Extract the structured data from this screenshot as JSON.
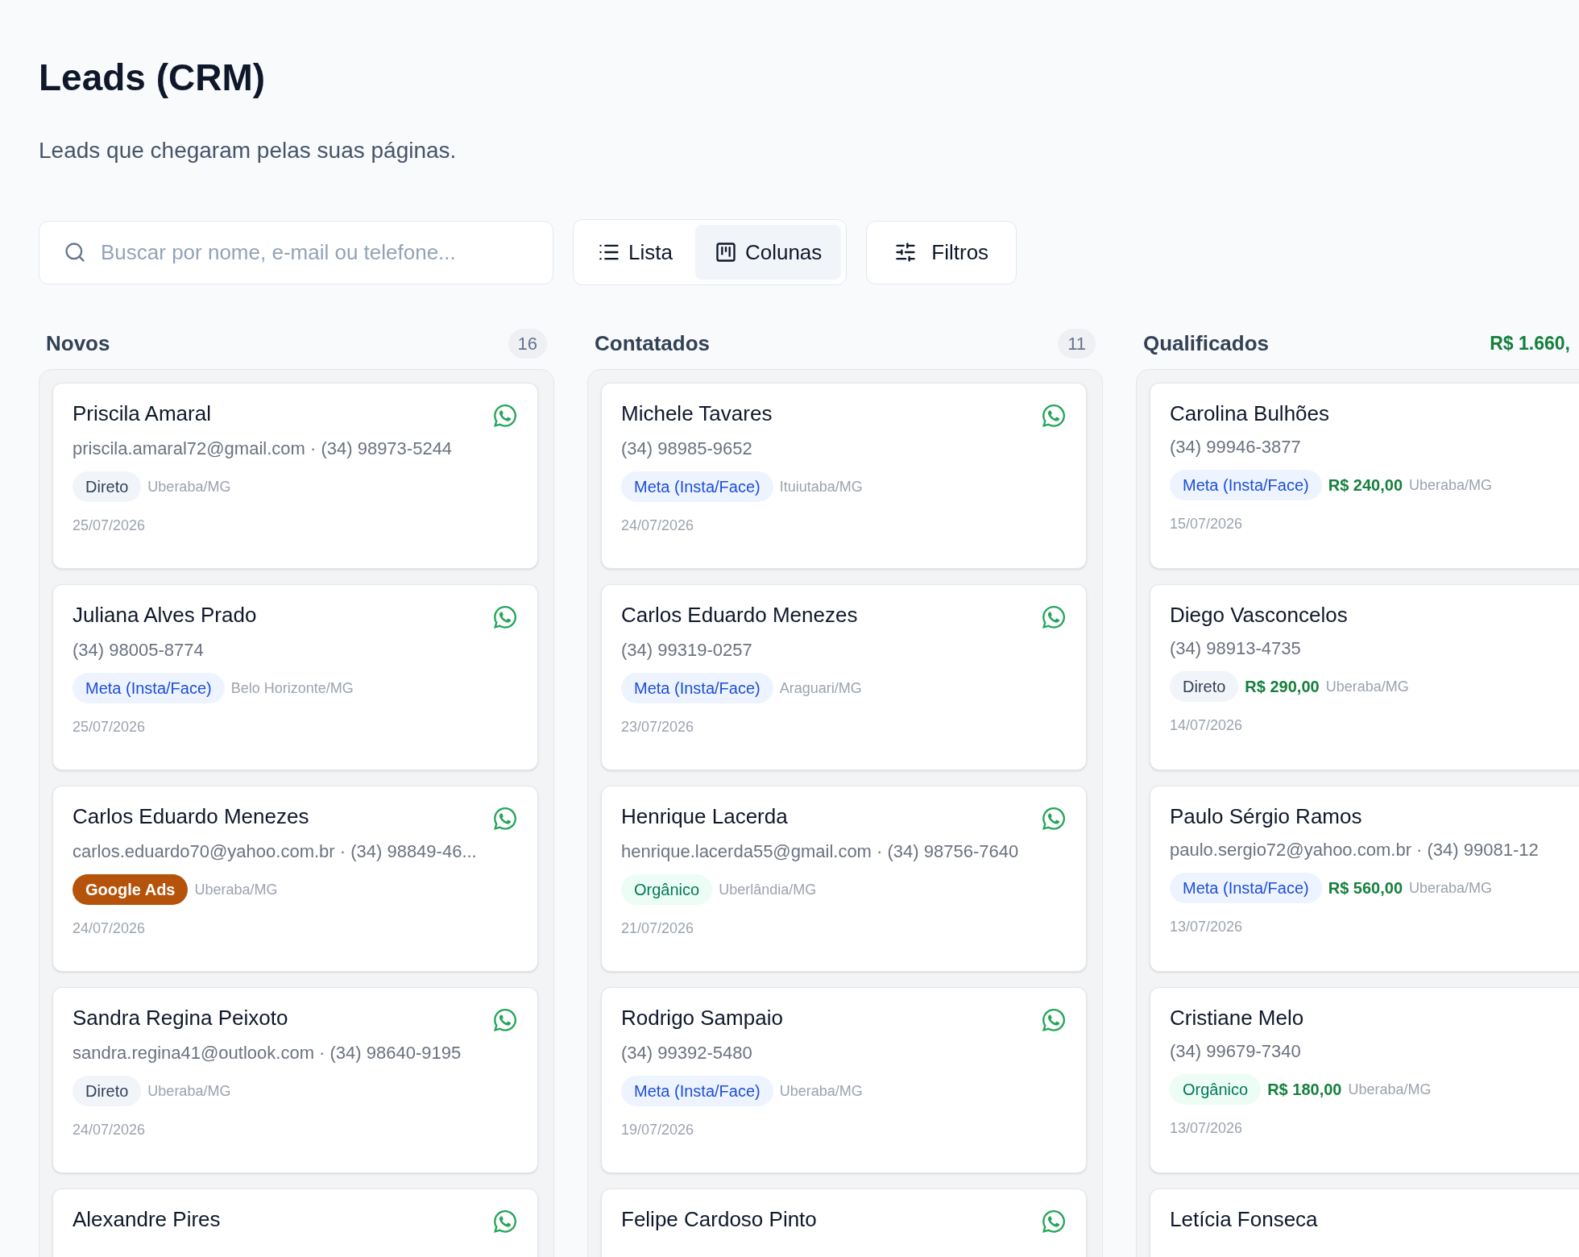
{
  "title": "Leads (CRM)",
  "subtitle": "Leads que chegaram pelas suas páginas.",
  "search": {
    "placeholder": "Buscar por nome, e-mail ou telefone..."
  },
  "views": [
    {
      "label": "Lista",
      "kind": "list",
      "selected": false
    },
    {
      "label": "Colunas",
      "kind": "columns",
      "selected": true
    }
  ],
  "filter_button": "Filtros",
  "columns": [
    {
      "title": "Novos",
      "count": "16",
      "cards": [
        {
          "name": "Priscila Amaral",
          "contact": "priscila.amaral72@gmail.com · (34) 98973-5244",
          "source": {
            "label": "Direto",
            "kind": "direto"
          },
          "city": "Uberaba/MG",
          "date": "25/07/2026"
        },
        {
          "name": "Juliana Alves Prado",
          "contact": "(34) 98005-8774",
          "source": {
            "label": "Meta (Insta/Face)",
            "kind": "meta"
          },
          "city": "Belo Horizonte/MG",
          "date": "25/07/2026"
        },
        {
          "name": "Carlos Eduardo Menezes",
          "contact": "carlos.eduardo70@yahoo.com.br · (34) 98849-46...",
          "source": {
            "label": "Google Ads",
            "kind": "google"
          },
          "city": "Uberaba/MG",
          "date": "24/07/2026"
        },
        {
          "name": "Sandra Regina Peixoto",
          "contact": "sandra.regina41@outlook.com · (34) 98640-9195",
          "source": {
            "label": "Direto",
            "kind": "direto"
          },
          "city": "Uberaba/MG",
          "date": "24/07/2026"
        },
        {
          "name": "Alexandre Pires"
        }
      ]
    },
    {
      "title": "Contatados",
      "count": "11",
      "cards": [
        {
          "name": "Michele Tavares",
          "contact": "(34) 98985-9652",
          "source": {
            "label": "Meta (Insta/Face)",
            "kind": "meta"
          },
          "city": "Ituiutaba/MG",
          "date": "24/07/2026"
        },
        {
          "name": "Carlos Eduardo Menezes",
          "contact": "(34) 99319-0257",
          "source": {
            "label": "Meta (Insta/Face)",
            "kind": "meta"
          },
          "city": "Araguari/MG",
          "date": "23/07/2026"
        },
        {
          "name": "Henrique Lacerda",
          "contact": "henrique.lacerda55@gmail.com · (34) 98756-7640",
          "source": {
            "label": "Orgânico",
            "kind": "organico"
          },
          "city": "Uberlândia/MG",
          "date": "21/07/2026"
        },
        {
          "name": "Rodrigo Sampaio",
          "contact": "(34) 99392-5480",
          "source": {
            "label": "Meta (Insta/Face)",
            "kind": "meta"
          },
          "city": "Uberaba/MG",
          "date": "19/07/2026"
        },
        {
          "name": "Felipe Cardoso Pinto"
        }
      ]
    },
    {
      "title": "Qualificados",
      "total": "R$ 1.660,",
      "cards": [
        {
          "name": "Carolina Bulhões",
          "contact": "(34) 99946-3877",
          "source": {
            "label": "Meta (Insta/Face)",
            "kind": "meta"
          },
          "value": "R$ 240,00",
          "city": "Uberaba/MG",
          "date": "15/07/2026"
        },
        {
          "name": "Diego Vasconcelos",
          "contact": "(34) 98913-4735",
          "source": {
            "label": "Direto",
            "kind": "direto"
          },
          "value": "R$ 290,00",
          "city": "Uberaba/MG",
          "date": "14/07/2026"
        },
        {
          "name": "Paulo Sérgio Ramos",
          "contact": "paulo.sergio72@yahoo.com.br · (34) 99081-12",
          "source": {
            "label": "Meta (Insta/Face)",
            "kind": "meta"
          },
          "value": "R$ 560,00",
          "city": "Uberaba/MG",
          "date": "13/07/2026"
        },
        {
          "name": "Cristiane Melo",
          "contact": "(34) 99679-7340",
          "source": {
            "label": "Orgânico",
            "kind": "organico"
          },
          "value": "R$ 180,00",
          "city": "Uberaba/MG",
          "date": "13/07/2026"
        },
        {
          "name": "Letícia Fonseca"
        }
      ]
    }
  ]
}
